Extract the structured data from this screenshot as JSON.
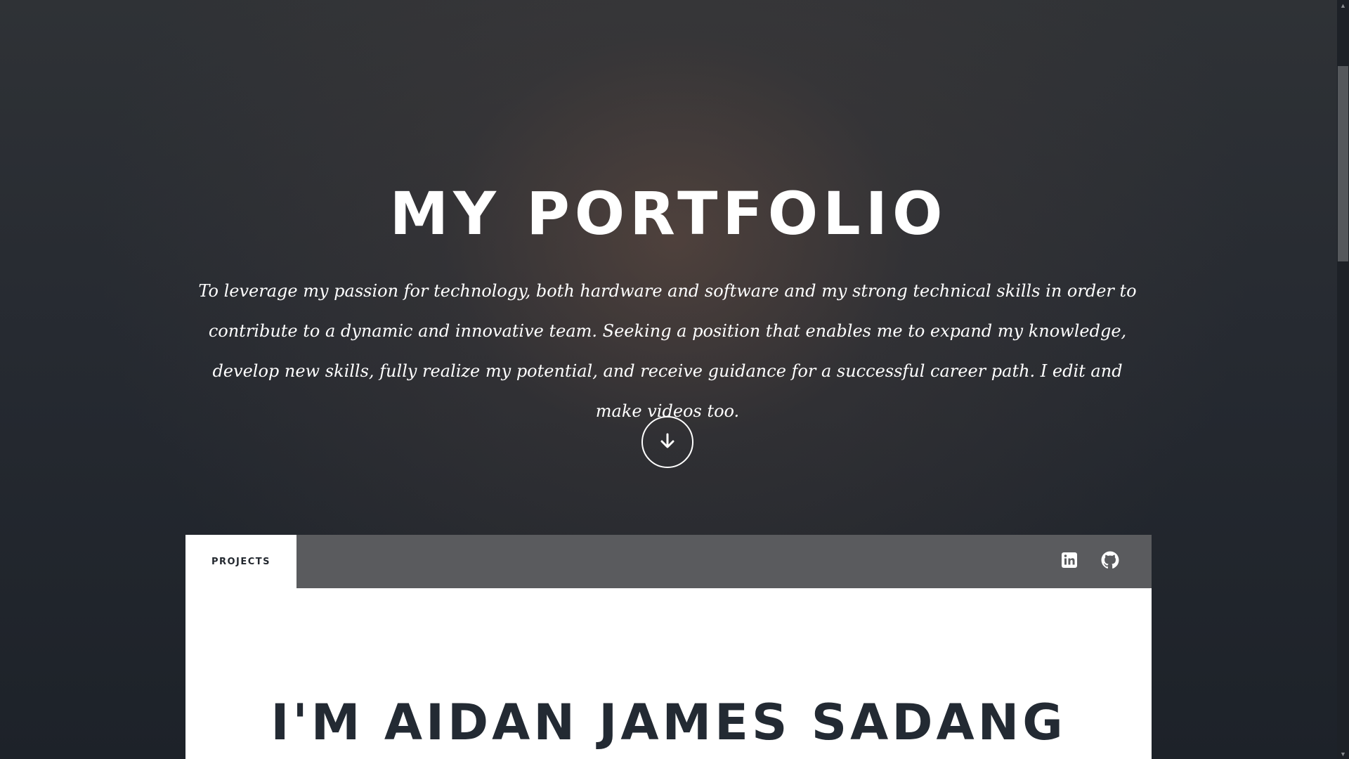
{
  "hero": {
    "title": "MY PORTFOLIO",
    "description": "To leverage my passion for technology, both hardware and software and my strong technical skills in order to contribute to a dynamic and innovative team. Seeking a position that enables me to expand my knowledge, develop new skills, fully realize my potential, and receive guidance for a successful career path. I edit and make videos too.",
    "scroll_icon": "arrow-down-icon"
  },
  "nav": {
    "tabs": [
      {
        "label": "PROJECTS",
        "active": true
      }
    ],
    "social": [
      {
        "icon": "linkedin-icon"
      },
      {
        "icon": "github-icon"
      }
    ]
  },
  "about": {
    "heading": "I'M AIDAN JAMES SADANG"
  },
  "colors": {
    "panel_background": "#ffffff",
    "tabbar_background": "#5a5b5e",
    "heading_text": "#232a33",
    "hero_text": "#ffffff"
  }
}
